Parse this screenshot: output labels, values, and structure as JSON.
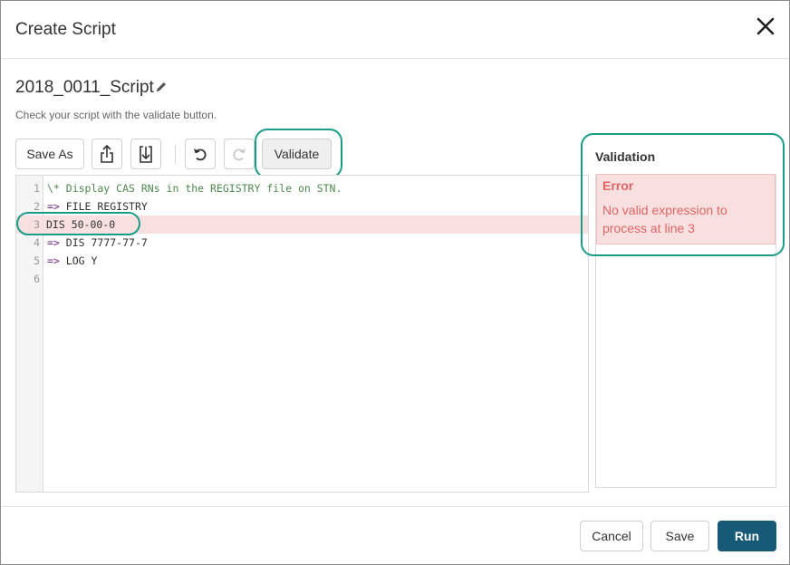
{
  "dialog": {
    "title": "Create Script",
    "close_icon": "close-icon"
  },
  "script": {
    "name": "2018_0011_Script",
    "edit_icon": "pencil-icon",
    "hint": "Check your script with the validate button."
  },
  "toolbar": {
    "save_as_label": "Save As",
    "upload_icon": "upload-icon",
    "download_icon": "download-icon",
    "undo_icon": "undo-icon",
    "redo_icon": "redo-icon",
    "validate_label": "Validate"
  },
  "editor": {
    "lines": [
      {
        "num": "1",
        "prefix": "",
        "text": "\\* Display CAS RNs in the REGISTRY file on STN.",
        "type": "comment"
      },
      {
        "num": "2",
        "prefix": "=>",
        "text": " FILE REGISTRY",
        "type": "command"
      },
      {
        "num": "3",
        "prefix": "",
        "text": "DIS 50-00-0",
        "type": "error"
      },
      {
        "num": "4",
        "prefix": "=>",
        "text": " DIS 7777-77-7",
        "type": "command"
      },
      {
        "num": "5",
        "prefix": "=>",
        "text": " LOG Y",
        "type": "command"
      },
      {
        "num": "6",
        "prefix": "",
        "text": "",
        "type": "empty"
      }
    ]
  },
  "validation": {
    "title": "Validation",
    "error_title": "Error",
    "error_message": "No valid expression to process at line 3"
  },
  "footer": {
    "cancel_label": "Cancel",
    "save_label": "Save",
    "run_label": "Run"
  },
  "colors": {
    "highlight": "#1a9c8a",
    "primary": "#165a78",
    "error_bg": "#f9e0e0",
    "error_text": "#e06464"
  }
}
